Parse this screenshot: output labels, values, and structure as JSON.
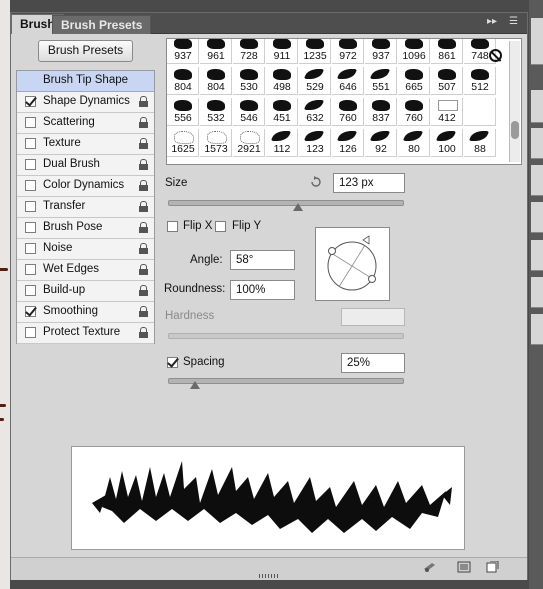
{
  "tabs": [
    {
      "label": "Brush",
      "active": true
    },
    {
      "label": "Brush Presets",
      "active": false
    }
  ],
  "brush_presets_button": "Brush Presets",
  "options": [
    {
      "label": "Brush Tip Shape",
      "checked": false,
      "header": true
    },
    {
      "label": "Shape Dynamics",
      "checked": true
    },
    {
      "label": "Scattering",
      "checked": false
    },
    {
      "label": "Texture",
      "checked": false
    },
    {
      "label": "Dual Brush",
      "checked": false
    },
    {
      "label": "Color Dynamics",
      "checked": false
    },
    {
      "label": "Transfer",
      "checked": false
    },
    {
      "label": "Brush Pose",
      "checked": false
    },
    {
      "label": "Noise",
      "checked": false
    },
    {
      "label": "Wet Edges",
      "checked": false
    },
    {
      "label": "Build-up",
      "checked": false
    },
    {
      "label": "Smoothing",
      "checked": true
    },
    {
      "label": "Protect Texture",
      "checked": false
    }
  ],
  "presets": [
    {
      "size": "937",
      "kind": "animal"
    },
    {
      "size": "961",
      "kind": "animal"
    },
    {
      "size": "728",
      "kind": "animal"
    },
    {
      "size": "911",
      "kind": "animal"
    },
    {
      "size": "1235",
      "kind": "animal"
    },
    {
      "size": "972",
      "kind": "animal"
    },
    {
      "size": "937",
      "kind": "animal"
    },
    {
      "size": "1096",
      "kind": "animal"
    },
    {
      "size": "861",
      "kind": "animal"
    },
    {
      "size": "748",
      "kind": "animal"
    },
    {
      "size": "804",
      "kind": "animal"
    },
    {
      "size": "804",
      "kind": "animal"
    },
    {
      "size": "530",
      "kind": "animal"
    },
    {
      "size": "498",
      "kind": "animal"
    },
    {
      "size": "529",
      "kind": "bird"
    },
    {
      "size": "646",
      "kind": "bird"
    },
    {
      "size": "551",
      "kind": "bird"
    },
    {
      "size": "665",
      "kind": "animal"
    },
    {
      "size": "507",
      "kind": "animal"
    },
    {
      "size": "512",
      "kind": "animal"
    },
    {
      "size": "556",
      "kind": "animal"
    },
    {
      "size": "532",
      "kind": "animal"
    },
    {
      "size": "546",
      "kind": "animal"
    },
    {
      "size": "451",
      "kind": "animal"
    },
    {
      "size": "632",
      "kind": "bird"
    },
    {
      "size": "760",
      "kind": "animal"
    },
    {
      "size": "837",
      "kind": "animal"
    },
    {
      "size": "760",
      "kind": "animal"
    },
    {
      "size": "412",
      "kind": "text"
    },
    {
      "size": "",
      "kind": "none"
    },
    {
      "size": "1625",
      "kind": "spatter"
    },
    {
      "size": "1573",
      "kind": "spatter"
    },
    {
      "size": "2921",
      "kind": "spatter"
    },
    {
      "size": "112",
      "kind": "bird"
    },
    {
      "size": "123",
      "kind": "bird"
    },
    {
      "size": "126",
      "kind": "bird"
    },
    {
      "size": "92",
      "kind": "bird"
    },
    {
      "size": "80",
      "kind": "bird"
    },
    {
      "size": "100",
      "kind": "bird"
    },
    {
      "size": "88",
      "kind": "bird"
    }
  ],
  "size": {
    "label": "Size",
    "value": "123 px"
  },
  "flip_x": {
    "label": "Flip X",
    "checked": false
  },
  "flip_y": {
    "label": "Flip Y",
    "checked": false
  },
  "angle": {
    "label": "Angle:",
    "value": "58°"
  },
  "roundness": {
    "label": "Roundness:",
    "value": "100%"
  },
  "hardness": {
    "label": "Hardness",
    "value": ""
  },
  "spacing": {
    "label": "Spacing",
    "value": "25%",
    "checked": true
  },
  "colors": {
    "panel": "#d6d6d6",
    "tab_bar": "#4e4e4e",
    "selected_row": "#c9d6f3"
  },
  "icons": [
    "forbid-icon",
    "lock-icon",
    "reset-size-icon",
    "panel-menu-icon",
    "toggle-live-tip-icon",
    "brush-editor-icon",
    "new-preset-icon"
  ]
}
